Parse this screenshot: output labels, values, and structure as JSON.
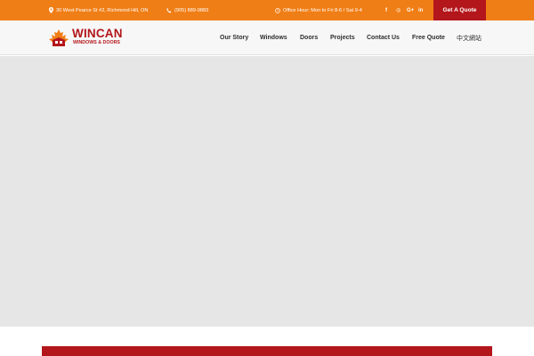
{
  "topbar": {
    "address": "30 West Pearce St #2, Richmond Hill, ON",
    "phone": "(905) 889-9883",
    "hours": "Office Hour: Mon to Fri 8-6 / Sat 9-4",
    "social": {
      "facebook": "f",
      "instagram": "◎",
      "googleplus": "G+",
      "linkedin": "in"
    },
    "quote_label": "Get A Quote",
    "icons": {
      "address": "map-pin-icon",
      "phone": "phone-icon",
      "hours": "clock-icon"
    }
  },
  "header": {
    "logo": {
      "name": "WINCAN",
      "subtitle": "WINDOWS & DOORS"
    },
    "nav": {
      "our_story": "Our Story",
      "windows": "Windows",
      "doors": "Doors",
      "projects": "Projects",
      "contact_us": "Contact Us",
      "free_quote": "Free Quote",
      "chinese": "中文網站"
    }
  },
  "colors": {
    "topbar": "#f07e16",
    "brand_red": "#b3161b",
    "header_bg": "#f7f7f7",
    "hero_bg": "#e6e6e6",
    "nav_text": "#2d2d2d"
  }
}
